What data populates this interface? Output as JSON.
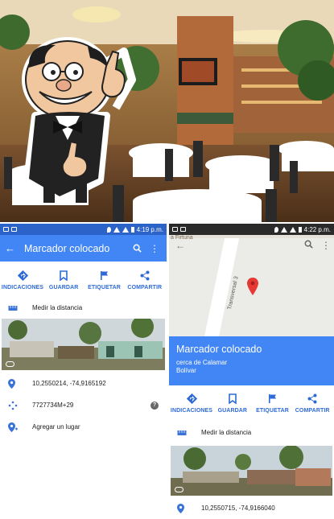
{
  "left_phone": {
    "status_time": "4:19 p.m.",
    "title": "Marcador colocado",
    "actions": [
      {
        "label": "INDICACIONES",
        "icon": "directions-icon"
      },
      {
        "label": "GUARDAR",
        "icon": "bookmark-icon"
      },
      {
        "label": "ETIQUETAR",
        "icon": "flag-icon"
      },
      {
        "label": "COMPARTIR",
        "icon": "share-icon"
      }
    ],
    "measure_label": "Medir la distancia",
    "coordinates": "10,2550214, -74,9165192",
    "plus_code": "7727734M+29",
    "add_place": "Agregar un lugar"
  },
  "right_phone": {
    "status_time": "4:22 p.m.",
    "map_top_label": "a Firtuna",
    "street_label": "Transversal 3",
    "title": "Marcador colocado",
    "subtitle_line1": "cerca de Calamar",
    "subtitle_line2": "Bolívar",
    "actions": [
      {
        "label": "INDICACIONES",
        "icon": "directions-icon"
      },
      {
        "label": "GUARDAR",
        "icon": "bookmark-icon"
      },
      {
        "label": "ETIQUETAR",
        "icon": "flag-icon"
      },
      {
        "label": "COMPARTIR",
        "icon": "share-icon"
      }
    ],
    "measure_label": "Medir la distancia",
    "coordinates": "10,2550715, -74,9166040"
  },
  "colors": {
    "app_blue": "#4285f4",
    "status_blue": "#2c63c9",
    "accent_blue": "#2d6ad8",
    "pin_red": "#e53935"
  }
}
